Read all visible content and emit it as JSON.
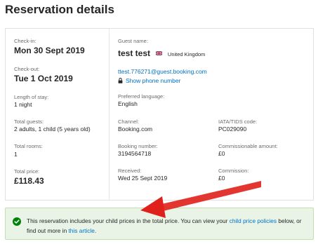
{
  "page": {
    "title": "Reservation details"
  },
  "checkin": {
    "label": "Check-in:",
    "value": "Mon 30 Sept 2019"
  },
  "checkout": {
    "label": "Check-out:",
    "value": "Tue 1 Oct 2019"
  },
  "stay": {
    "label": "Length of stay:",
    "value": "1 night"
  },
  "guests": {
    "label": "Total guests:",
    "value": "2 adults, 1 child (5 years old)"
  },
  "rooms": {
    "label": "Total rooms:",
    "value": "1"
  },
  "price": {
    "label": "Total price:",
    "value": "£118.43"
  },
  "guest": {
    "label": "Guest name:",
    "name": "test test",
    "country": "United Kingdom",
    "flag_icon": "uk-flag-icon",
    "email": "ttest.776271@guest.booking.com",
    "phone_link": "Show phone number",
    "phone_icon": "lock-icon"
  },
  "language": {
    "label": "Preferred language:",
    "value": "English"
  },
  "channel": {
    "label": "Channel:",
    "value": "Booking.com"
  },
  "iata": {
    "label": "IATA/TIDS code:",
    "value": "PC029090"
  },
  "booking_number": {
    "label": "Booking number:",
    "value": "3194564718"
  },
  "commissionable": {
    "label": "Commissionable amount:",
    "value": "£0"
  },
  "received": {
    "label": "Received:",
    "value": "Wed 25 Sept 2019"
  },
  "commission": {
    "label": "Commission:",
    "value": "£0"
  },
  "notice": {
    "text_1": "This reservation includes your child prices in the total price. You can view your",
    "link_1": "child price policies",
    "text_2": "below, or find out more in",
    "link_2": "this article",
    "text_3": ".",
    "icon": "check-circle-icon"
  },
  "colors": {
    "link": "#0071c2",
    "success": "#008009",
    "notice_bg": "#eaf4e6",
    "arrow": "#e0201b"
  }
}
